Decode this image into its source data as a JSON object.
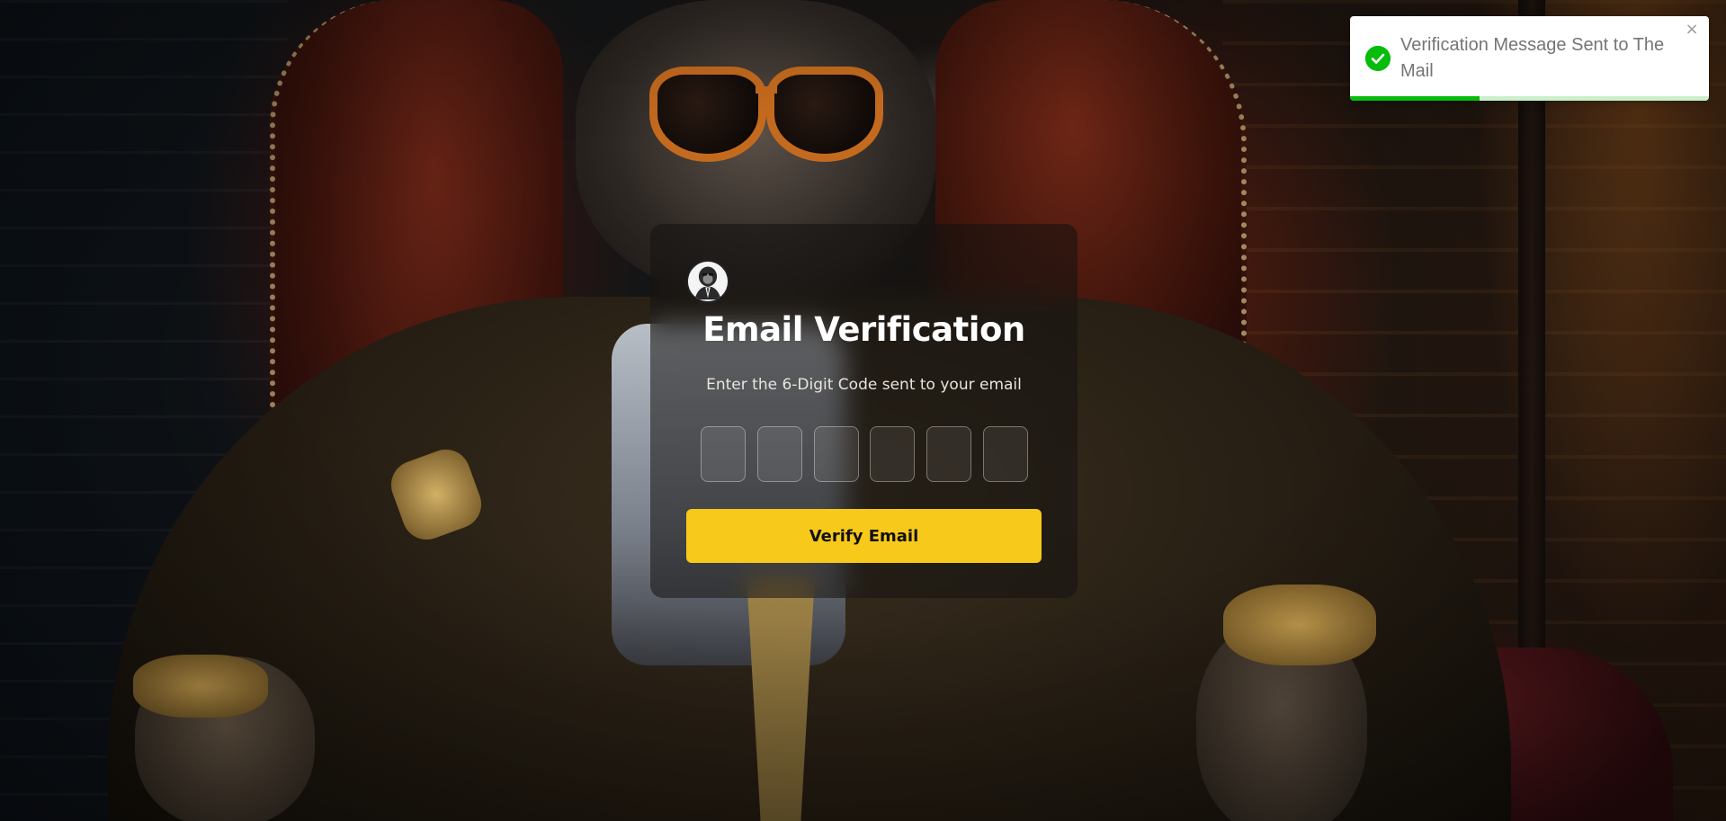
{
  "card": {
    "title": "Email Verification",
    "subtitle": "Enter the 6-Digit Code sent to your email",
    "logo_icon": "gorilla-avatar-icon",
    "code_digits": [
      "",
      "",
      "",
      "",
      "",
      ""
    ],
    "verify_button_label": "Verify Email"
  },
  "toast": {
    "message": "Verification Message Sent to The Mail",
    "status": "success",
    "status_icon": "check-circle-icon",
    "close_icon": "close-icon",
    "close_glyph": "×",
    "progress_remaining": 0.36
  },
  "colors": {
    "accent_button": "#f7c91a",
    "success": "#07bc0c",
    "toast_text": "#757575"
  }
}
